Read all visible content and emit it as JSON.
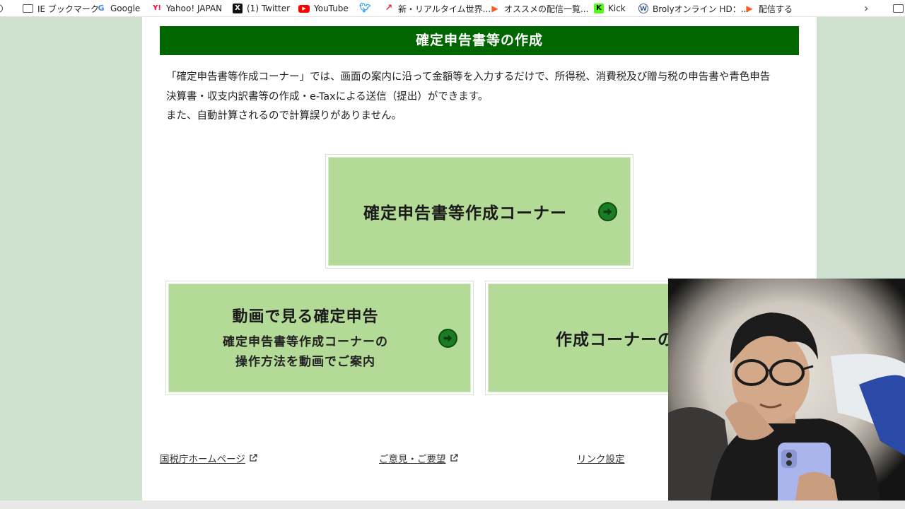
{
  "bookmarks": [
    {
      "label": "IE ブックマーク",
      "icon": "folder-icon"
    },
    {
      "label": "Google",
      "icon": "google-icon"
    },
    {
      "label": "Yahoo! JAPAN",
      "icon": "yahoo-icon"
    },
    {
      "label": "(1) Twitter",
      "icon": "x-icon"
    },
    {
      "label": "YouTube",
      "icon": "youtube-icon"
    },
    {
      "label": "",
      "icon": "twitter-bird-icon"
    },
    {
      "label": "新・リアルタイム世界...",
      "icon": "chart-icon"
    },
    {
      "label": "オススメの配信一覧...",
      "icon": "play-icon"
    },
    {
      "label": "Kick",
      "icon": "kick-icon"
    },
    {
      "label": "Brolyオンライン HD：...",
      "icon": "wordpress-icon"
    },
    {
      "label": "配信する",
      "icon": "play-icon"
    }
  ],
  "page": {
    "header_title": "確定申告書等の作成",
    "intro_lines": [
      "「確定申告書等作成コーナー」では、画面の案内に沿って金額等を入力するだけで、所得税、消費税及び贈与税の申告書や青色申告",
      "決算書・収支内訳書等の作成・e-Taxによる送信（提出）ができます。",
      "また、自動計算されるので計算誤りがありません。"
    ],
    "card_main_label": "確定申告書等作成コーナー",
    "card_video_title": "動画で見る確定申告",
    "card_video_sub1": "確定申告書等作成コーナーの",
    "card_video_sub2": "操作方法を動画でご案内",
    "card_ops_label": "作成コーナーの操",
    "footer": {
      "nta_link": "国税庁ホームページ",
      "feedback_link": "ご意見・ご要望",
      "link_settings": "リンク設定"
    }
  },
  "colors": {
    "header_green": "#006600",
    "card_green": "#b3da96",
    "arrow_green": "#1a7d22",
    "side_bg": "#cfe2cf"
  }
}
